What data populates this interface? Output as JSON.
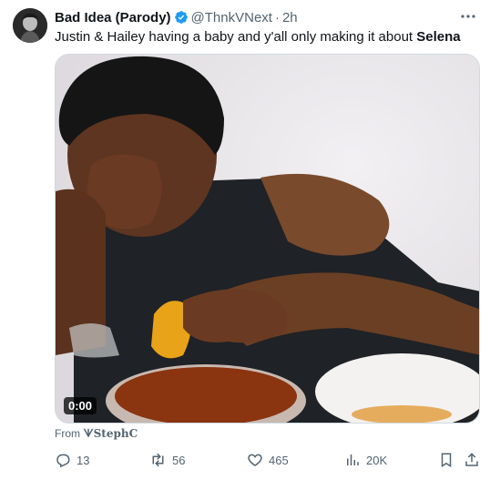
{
  "author": {
    "display_name": "Bad Idea (Parody)",
    "handle": "@ThnkVNext",
    "separator": "·",
    "time": "2h",
    "verified_color": "#1d9bf0"
  },
  "post": {
    "text_main": "Justin & Hailey having a baby and y'all only making it about",
    "text_bold": "Selena"
  },
  "media": {
    "duration": "0:00"
  },
  "attribution": {
    "prefix": "From",
    "source": "ᗐStephC"
  },
  "actions": {
    "replies": "13",
    "reposts": "56",
    "likes": "465",
    "views": "20K"
  },
  "icons": [
    "more-icon",
    "verified-icon",
    "reply-icon",
    "repost-icon",
    "like-icon",
    "views-icon",
    "bookmark-icon",
    "share-icon"
  ]
}
